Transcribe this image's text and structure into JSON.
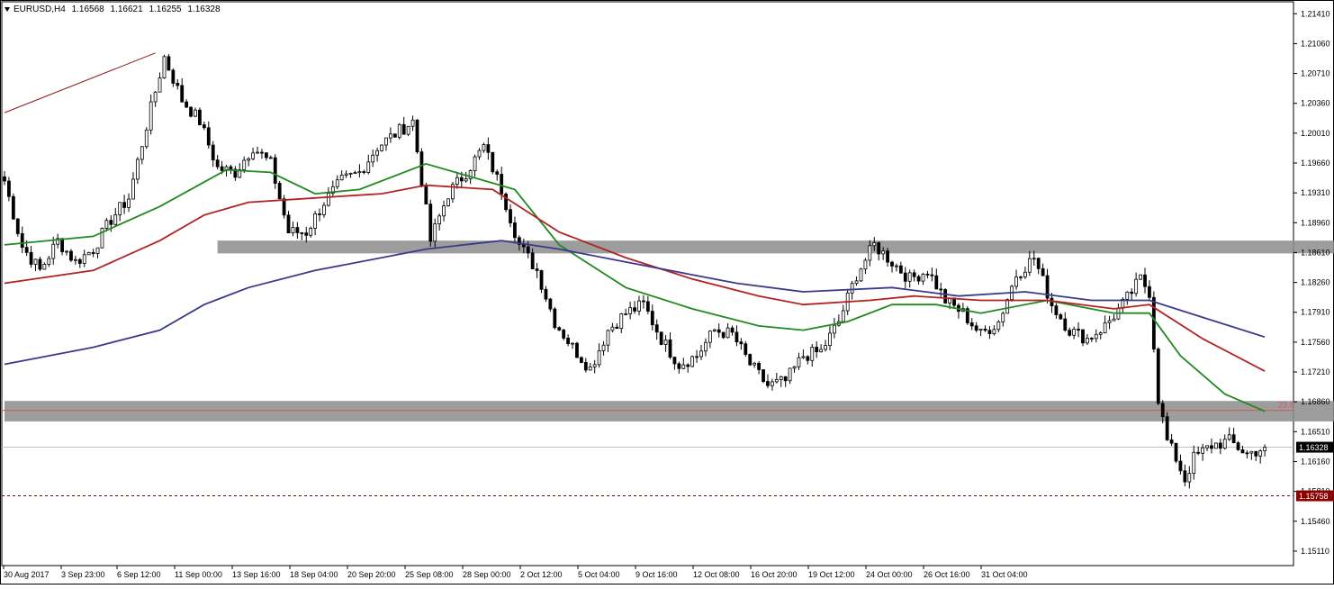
{
  "header": {
    "symbol": "EURUSD,H4",
    "open": "1.16568",
    "high": "1.16621",
    "low": "1.16255",
    "close": "1.16328"
  },
  "colors": {
    "candle": "#000000",
    "zone": "#8c8c8c",
    "ma_fast": "#1f8a1f",
    "ma_mid": "#b22222",
    "ma_slow": "#3a3a8c",
    "trendline": "#8b1a1a",
    "fib_line": "#cd5c5c",
    "current_label_bg": "#000000",
    "stop_label_bg": "#8b0000"
  },
  "chart_data": {
    "type": "candlestick",
    "symbol": "EURUSD",
    "timeframe": "H4",
    "ylim": [
      1.1494,
      1.2155
    ],
    "y_ticks": [
      "1.21410",
      "1.21060",
      "1.20710",
      "1.20360",
      "1.20010",
      "1.19660",
      "1.19310",
      "1.18960",
      "1.18610",
      "1.18260",
      "1.17910",
      "1.17560",
      "1.17210",
      "1.16860",
      "1.16510",
      "1.16160",
      "1.15810",
      "1.15460",
      "1.15110"
    ],
    "x_labels": [
      "30 Aug 2017",
      "3 Sep 23:00",
      "6 Sep 12:00",
      "11 Sep 00:00",
      "13 Sep 16:00",
      "18 Sep 04:00",
      "20 Sep 20:00",
      "25 Sep 08:00",
      "28 Sep 00:00",
      "2 Oct 12:00",
      "5 Oct 04:00",
      "9 Oct 16:00",
      "12 Oct 08:00",
      "16 Oct 20:00",
      "19 Oct 12:00",
      "24 Oct 00:00",
      "26 Oct 16:00",
      "31 Oct 04:00"
    ],
    "close_path": [
      [
        0,
        1.1945
      ],
      [
        4,
        1.1868
      ],
      [
        8,
        1.184
      ],
      [
        12,
        1.1875
      ],
      [
        16,
        1.185
      ],
      [
        20,
        1.1865
      ],
      [
        24,
        1.19
      ],
      [
        28,
        1.1925
      ],
      [
        32,
        1.201
      ],
      [
        36,
        1.209
      ],
      [
        40,
        1.204
      ],
      [
        44,
        1.2015
      ],
      [
        48,
        1.196
      ],
      [
        52,
        1.1955
      ],
      [
        56,
        1.1985
      ],
      [
        60,
        1.1965
      ],
      [
        64,
        1.1885
      ],
      [
        68,
        1.1885
      ],
      [
        72,
        1.192
      ],
      [
        76,
        1.1945
      ],
      [
        80,
        1.1955
      ],
      [
        84,
        1.1985
      ],
      [
        88,
        1.2
      ],
      [
        92,
        1.2015
      ],
      [
        96,
        1.1875
      ],
      [
        100,
        1.193
      ],
      [
        104,
        1.1955
      ],
      [
        108,
        1.1985
      ],
      [
        112,
        1.1935
      ],
      [
        116,
        1.187
      ],
      [
        120,
        1.184
      ],
      [
        124,
        1.178
      ],
      [
        128,
        1.175
      ],
      [
        132,
        1.1725
      ],
      [
        136,
        1.177
      ],
      [
        140,
        1.179
      ],
      [
        144,
        1.18
      ],
      [
        148,
        1.176
      ],
      [
        152,
        1.173
      ],
      [
        156,
        1.174
      ],
      [
        160,
        1.177
      ],
      [
        164,
        1.1765
      ],
      [
        168,
        1.173
      ],
      [
        172,
        1.1705
      ],
      [
        176,
        1.171
      ],
      [
        180,
        1.174
      ],
      [
        184,
        1.1745
      ],
      [
        188,
        1.178
      ],
      [
        192,
        1.1835
      ],
      [
        196,
        1.187
      ],
      [
        200,
        1.185
      ],
      [
        204,
        1.183
      ],
      [
        208,
        1.184
      ],
      [
        212,
        1.1805
      ],
      [
        216,
        1.179
      ],
      [
        220,
        1.1765
      ],
      [
        224,
        1.178
      ],
      [
        228,
        1.1835
      ],
      [
        232,
        1.1855
      ],
      [
        236,
        1.18
      ],
      [
        240,
        1.177
      ],
      [
        244,
        1.176
      ],
      [
        248,
        1.1775
      ],
      [
        252,
        1.18
      ],
      [
        256,
        1.183
      ],
      [
        258,
        1.1815
      ],
      [
        260,
        1.169
      ],
      [
        262,
        1.164
      ],
      [
        264,
        1.162
      ],
      [
        266,
        1.1595
      ],
      [
        268,
        1.162
      ],
      [
        272,
        1.1635
      ],
      [
        276,
        1.164
      ],
      [
        280,
        1.1625
      ],
      [
        284,
        1.1632
      ]
    ],
    "series": [
      {
        "name": "",
        "type": "moving-average",
        "color": "#1f8a1f",
        "points": [
          [
            0,
            1.187
          ],
          [
            20,
            1.188
          ],
          [
            35,
            1.1915
          ],
          [
            50,
            1.1958
          ],
          [
            60,
            1.1955
          ],
          [
            70,
            1.193
          ],
          [
            80,
            1.1935
          ],
          [
            95,
            1.1965
          ],
          [
            105,
            1.195
          ],
          [
            115,
            1.1935
          ],
          [
            125,
            1.187
          ],
          [
            140,
            1.182
          ],
          [
            155,
            1.1795
          ],
          [
            170,
            1.1775
          ],
          [
            180,
            1.177
          ],
          [
            190,
            1.178
          ],
          [
            200,
            1.18
          ],
          [
            210,
            1.18
          ],
          [
            220,
            1.179
          ],
          [
            235,
            1.1805
          ],
          [
            250,
            1.179
          ],
          [
            258,
            1.179
          ],
          [
            265,
            1.174
          ],
          [
            275,
            1.1695
          ],
          [
            284,
            1.1675
          ]
        ]
      },
      {
        "name": "",
        "type": "moving-average",
        "color": "#b22222",
        "points": [
          [
            0,
            1.1825
          ],
          [
            20,
            1.184
          ],
          [
            35,
            1.1875
          ],
          [
            45,
            1.1905
          ],
          [
            55,
            1.192
          ],
          [
            70,
            1.1925
          ],
          [
            85,
            1.193
          ],
          [
            95,
            1.194
          ],
          [
            110,
            1.1935
          ],
          [
            125,
            1.1885
          ],
          [
            140,
            1.1855
          ],
          [
            155,
            1.183
          ],
          [
            170,
            1.181
          ],
          [
            180,
            1.18
          ],
          [
            195,
            1.1805
          ],
          [
            205,
            1.181
          ],
          [
            220,
            1.1805
          ],
          [
            235,
            1.1805
          ],
          [
            250,
            1.1795
          ],
          [
            258,
            1.18
          ],
          [
            270,
            1.176
          ],
          [
            284,
            1.1722
          ]
        ]
      },
      {
        "name": "",
        "type": "moving-average",
        "color": "#3a3a8c",
        "points": [
          [
            0,
            1.173
          ],
          [
            20,
            1.175
          ],
          [
            35,
            1.177
          ],
          [
            45,
            1.18
          ],
          [
            55,
            1.182
          ],
          [
            70,
            1.184
          ],
          [
            85,
            1.1855
          ],
          [
            95,
            1.1865
          ],
          [
            112,
            1.1875
          ],
          [
            125,
            1.1865
          ],
          [
            140,
            1.185
          ],
          [
            155,
            1.1835
          ],
          [
            165,
            1.1825
          ],
          [
            180,
            1.1815
          ],
          [
            200,
            1.182
          ],
          [
            215,
            1.181
          ],
          [
            230,
            1.1815
          ],
          [
            245,
            1.1805
          ],
          [
            258,
            1.1805
          ],
          [
            270,
            1.1785
          ],
          [
            284,
            1.1762
          ]
        ]
      }
    ],
    "zones": [
      {
        "x": [
          48,
          320
        ],
        "y": [
          1.186,
          1.1875
        ]
      },
      {
        "x": [
          0,
          318
        ],
        "y": [
          1.1663,
          1.1687
        ]
      }
    ],
    "trendline": {
      "from": [
        0,
        1.2025
      ],
      "to": [
        34,
        1.2095
      ]
    },
    "fib_level": {
      "label": "23.6",
      "value": 1.1676
    },
    "current_price": {
      "value": 1.16328,
      "label": "1.16328"
    },
    "stop_level": {
      "value": 1.15758,
      "label": "1.15758"
    }
  }
}
